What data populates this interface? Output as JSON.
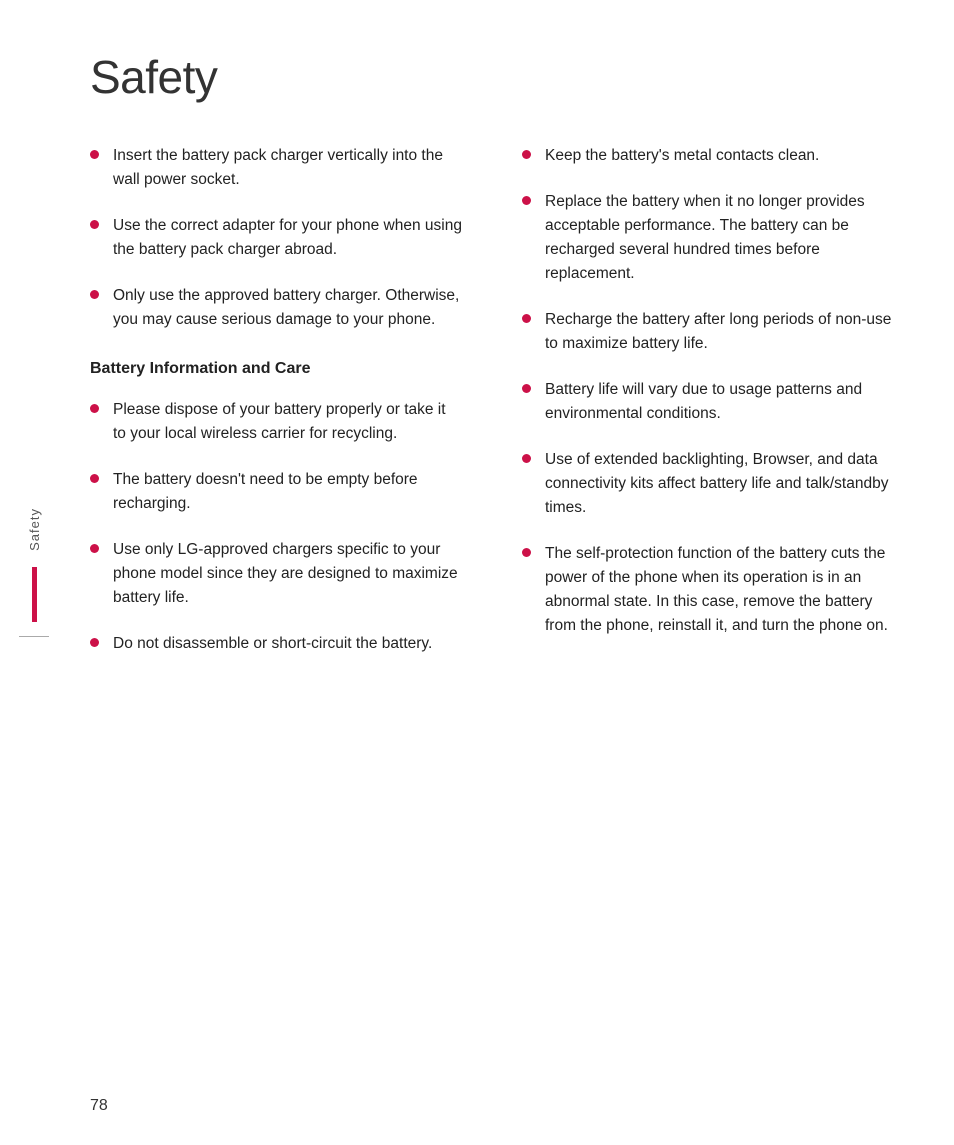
{
  "page": {
    "title": "Safety",
    "page_number": "78",
    "sidebar_label": "Safety"
  },
  "left_column": {
    "intro_bullets": [
      {
        "id": "bullet-1",
        "text": "Insert the battery pack charger vertically into the wall power socket."
      },
      {
        "id": "bullet-2",
        "text": "Use the correct adapter for your phone when using the battery pack charger abroad."
      },
      {
        "id": "bullet-3",
        "text": "Only use the approved battery charger. Otherwise, you may cause serious damage to your phone."
      }
    ],
    "section_heading": "Battery Information and Care",
    "section_bullets": [
      {
        "id": "bullet-4",
        "text": "Please dispose of your battery properly or take it to your local wireless carrier for recycling."
      },
      {
        "id": "bullet-5",
        "text": "The battery doesn't need to be empty before recharging."
      },
      {
        "id": "bullet-6",
        "text": "Use only LG-approved chargers specific to your phone model since they are designed to maximize battery life."
      },
      {
        "id": "bullet-7",
        "text": "Do not disassemble or short-circuit the battery."
      }
    ]
  },
  "right_column": {
    "bullets": [
      {
        "id": "bullet-r1",
        "text": "Keep the battery's metal contacts clean."
      },
      {
        "id": "bullet-r2",
        "text": "Replace the battery when it no longer provides acceptable performance. The battery can be recharged several hundred times before replacement."
      },
      {
        "id": "bullet-r3",
        "text": "Recharge the battery after long periods of non-use to maximize battery life."
      },
      {
        "id": "bullet-r4",
        "text": "Battery life will vary due to usage patterns and environmental conditions."
      },
      {
        "id": "bullet-r5",
        "text": "Use of extended backlighting, Browser, and data connectivity kits affect battery life and talk/standby times."
      },
      {
        "id": "bullet-r6",
        "text": "The self-protection function of the battery cuts the power of the phone when its operation is in an abnormal state. In this case, remove the battery from the phone, reinstall it, and turn the phone on."
      }
    ]
  },
  "accent_color": "#cc1148"
}
